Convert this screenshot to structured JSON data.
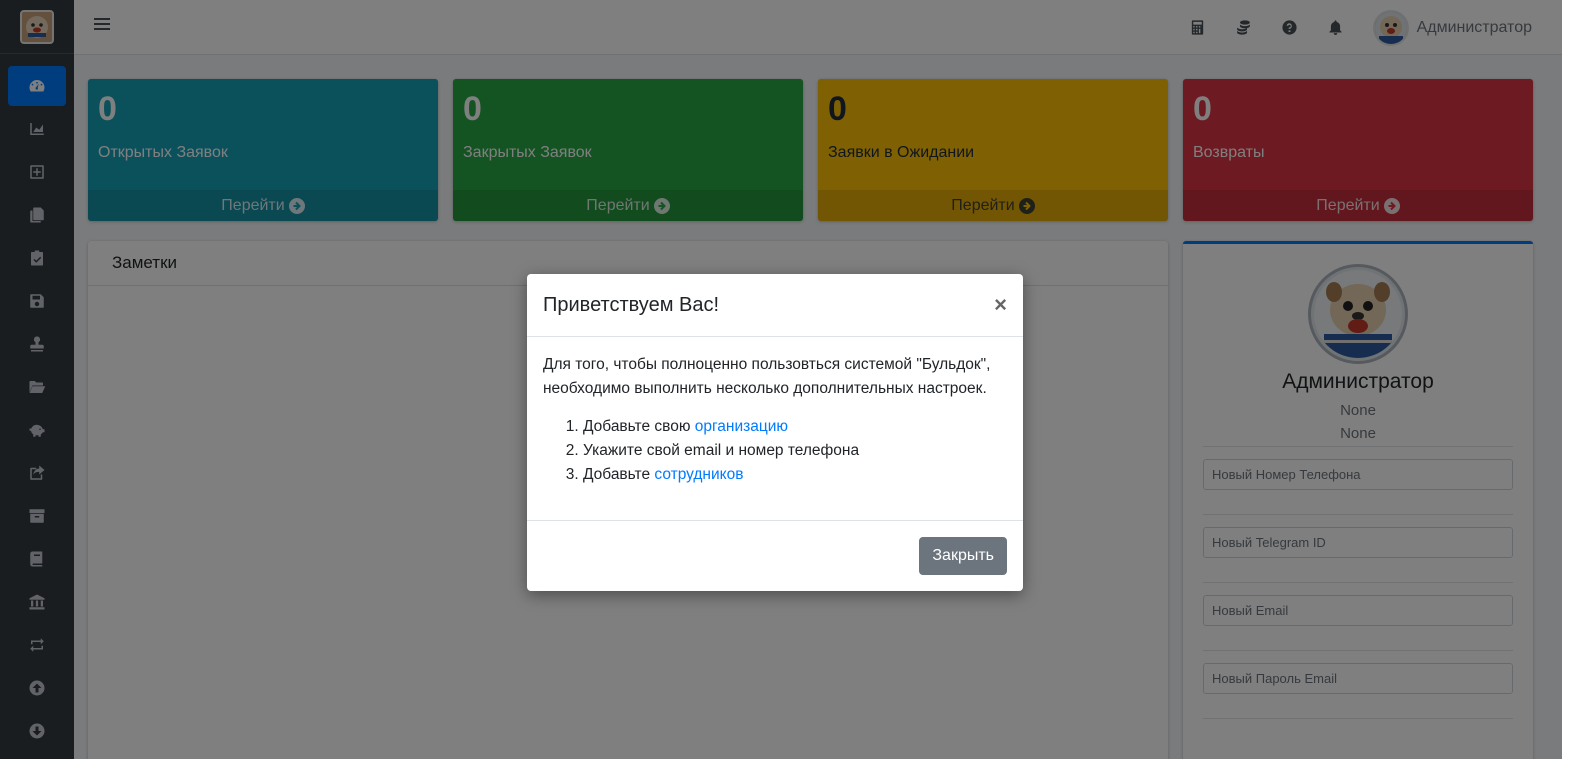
{
  "sidebar": {
    "brand_icon": "bulldog-logo",
    "items": [
      {
        "icon": "dashboard-icon",
        "active": true
      },
      {
        "icon": "area-chart-icon"
      },
      {
        "icon": "plus-square-icon"
      },
      {
        "icon": "copy-icon"
      },
      {
        "icon": "clipboard-check-icon"
      },
      {
        "icon": "save-icon"
      },
      {
        "icon": "stamp-icon"
      },
      {
        "icon": "folder-open-icon"
      },
      {
        "icon": "piggy-bank-icon"
      },
      {
        "icon": "share-square-icon"
      },
      {
        "icon": "archive-icon"
      },
      {
        "icon": "book-icon"
      },
      {
        "icon": "bank-icon"
      },
      {
        "icon": "exchange-icon"
      },
      {
        "icon": "arrow-circle-up-icon"
      },
      {
        "icon": "arrow-circle-down-icon"
      }
    ]
  },
  "navbar": {
    "menu_icon": "hamburger-icon",
    "icons": [
      "calculator-icon",
      "coins-icon",
      "question-circle-icon",
      "bell-icon"
    ],
    "user_name": "Администратор"
  },
  "stats": [
    {
      "value": "0",
      "label": "Открытых Заявок",
      "link": "Перейти",
      "color": "#17a2b8"
    },
    {
      "value": "0",
      "label": "Закрытых Заявок",
      "link": "Перейти",
      "color": "#28a745"
    },
    {
      "value": "0",
      "label": "Заявки в Ожидании",
      "link": "Перейти",
      "color": "#ffc107"
    },
    {
      "value": "0",
      "label": "Возвраты",
      "link": "Перейти",
      "color": "#dc3545"
    }
  ],
  "notes": {
    "title": "Заметки"
  },
  "profile": {
    "name": "Администратор",
    "line1": "None",
    "line2": "None",
    "fields": [
      {
        "placeholder": "Новый Номер Телефона"
      },
      {
        "placeholder": "Новый Telegram ID"
      },
      {
        "placeholder": "Новый Email"
      },
      {
        "placeholder": "Новый Пароль Email"
      }
    ]
  },
  "modal": {
    "title": "Приветствуем Вас!",
    "close_symbol": "×",
    "intro": "Для того, чтобы полноценно пользовться системой \"Бульдок\", необходимо выполнить несколько дополнительных настроек.",
    "steps": [
      {
        "text": "Добавьте свою ",
        "link": "организацию"
      },
      {
        "text": "Укажите свой email и номер телефона",
        "link": ""
      },
      {
        "text": "Добавьте ",
        "link": "сотрудников"
      }
    ],
    "button": "Закрыть"
  },
  "colors": {
    "primary": "#007bff",
    "sidebar_bg": "#343a40",
    "overlay": "rgba(0,0,0,0.5)"
  }
}
